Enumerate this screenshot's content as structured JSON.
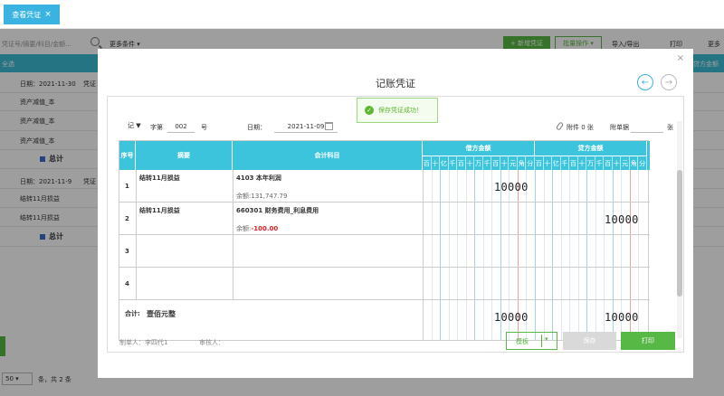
{
  "tab": {
    "label": "查看凭证",
    "close": "×"
  },
  "background": {
    "search_placeholder": "凭证号/摘要/科目/金额...",
    "more_conditions": "更多条件 ▾",
    "new_button": "+ 新增凭证",
    "batch_button": "批量操作 ▾",
    "import_export": "导入/导出",
    "print": "打印",
    "more_right": "更多",
    "header_left": "全选",
    "header_right": "贷方金额",
    "entries": [
      {
        "date": "日期：2021-11-30",
        "voucher": "凭证",
        "lines": [
          "资产减值_本",
          "资产减值_本",
          "资产减值_本"
        ],
        "total": "总计"
      },
      {
        "date": "日期：2021-11-9",
        "voucher": "凭证",
        "lines": [
          "结转11月损益",
          "结转11月损益"
        ],
        "total": "总计"
      }
    ],
    "pager_size": "50",
    "pager_text": "条，共 2 条"
  },
  "modal": {
    "title": "记账凭证",
    "close": "×",
    "prev": "←",
    "next": "→",
    "toast": "保存凭证成功！",
    "word": "记 ▼",
    "number_label": "字第",
    "number": "002",
    "number_suffix": "号",
    "date_label": "日期：",
    "date": "2021-11-09",
    "attach_label": "附件 0 张",
    "bill_label": "附单据",
    "bill_suffix": "张",
    "headers": {
      "seq": "序号",
      "summary": "摘要",
      "account": "会计科目",
      "debit": "借方金额",
      "credit": "贷方金额"
    },
    "units": [
      "百",
      "十",
      "亿",
      "千",
      "百",
      "十",
      "万",
      "千",
      "百",
      "十",
      "元",
      "角",
      "分"
    ],
    "rows": [
      {
        "seq": "1",
        "summary": "结转11月损益",
        "account": "4103 本年利润",
        "balance_label": "余额:",
        "balance": "131,747.79",
        "debit": "10000",
        "credit": ""
      },
      {
        "seq": "2",
        "summary": "结转11月损益",
        "account": "660301 财务费用_利息费用",
        "balance_label": "余额:",
        "balance": "-100.00",
        "debit": "",
        "credit": "10000"
      },
      {
        "seq": "3",
        "summary": "",
        "account": "",
        "balance": "",
        "debit": "",
        "credit": ""
      },
      {
        "seq": "4",
        "summary": "",
        "account": "",
        "balance": "",
        "debit": "",
        "credit": ""
      }
    ],
    "total_label": "合计:",
    "total_text": "壹佰元整",
    "total_debit": "10000",
    "total_credit": "10000",
    "maker": "制单人：李四代1",
    "reviewer": "审核人：",
    "template_button": "模板",
    "template_caret": "▾",
    "save_button": "保存",
    "print_button": "打印"
  },
  "colors": {
    "accent": "#3bb3e0",
    "header": "#3cc4dc",
    "green": "#57b845",
    "toast": "#5db82f"
  }
}
